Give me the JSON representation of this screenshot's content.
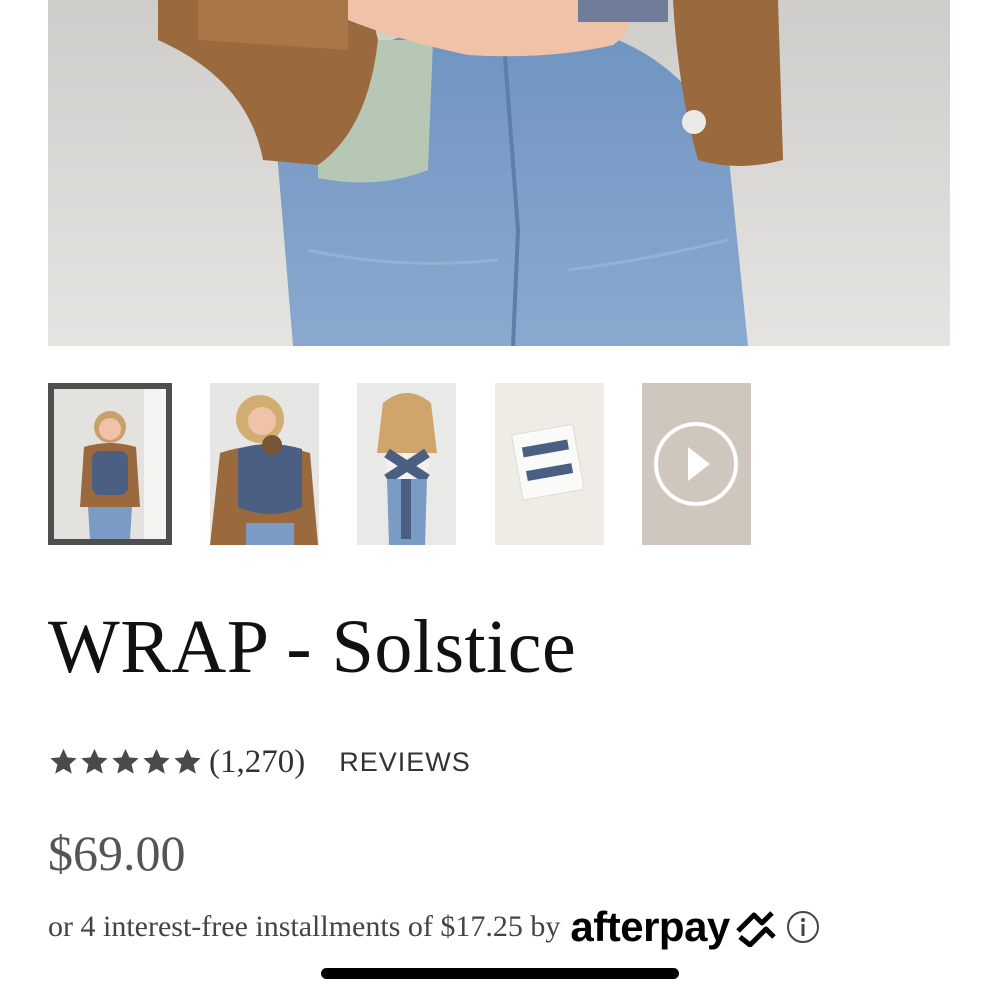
{
  "gallery": {
    "main_image_alt": "Woman wearing blue jeans and brown cardigan",
    "thumbnails": [
      {
        "label": "front view wearing wrap",
        "selected": true
      },
      {
        "label": "baby in wrap",
        "selected": false
      },
      {
        "label": "back view tied",
        "selected": false
      },
      {
        "label": "packaging box",
        "selected": false
      },
      {
        "label": "video",
        "selected": false
      }
    ]
  },
  "product": {
    "title": "WRAP - Solstice",
    "rating": 5,
    "review_count": "(1,270)",
    "reviews_link": "REVIEWS",
    "price": "$69.00"
  },
  "installments": {
    "text": "or 4 interest-free installments of $17.25 by",
    "provider": "afterpay"
  },
  "colors": {
    "wrap_blue": "#4b5f82",
    "cardigan": "#9a6a3e",
    "denim": "#7a9cc4",
    "star": "#4a4a4a"
  },
  "icons": {
    "star": "star-icon",
    "play": "play-icon",
    "afterpay_mark": "afterpay-arrows-icon",
    "info": "info-icon"
  }
}
